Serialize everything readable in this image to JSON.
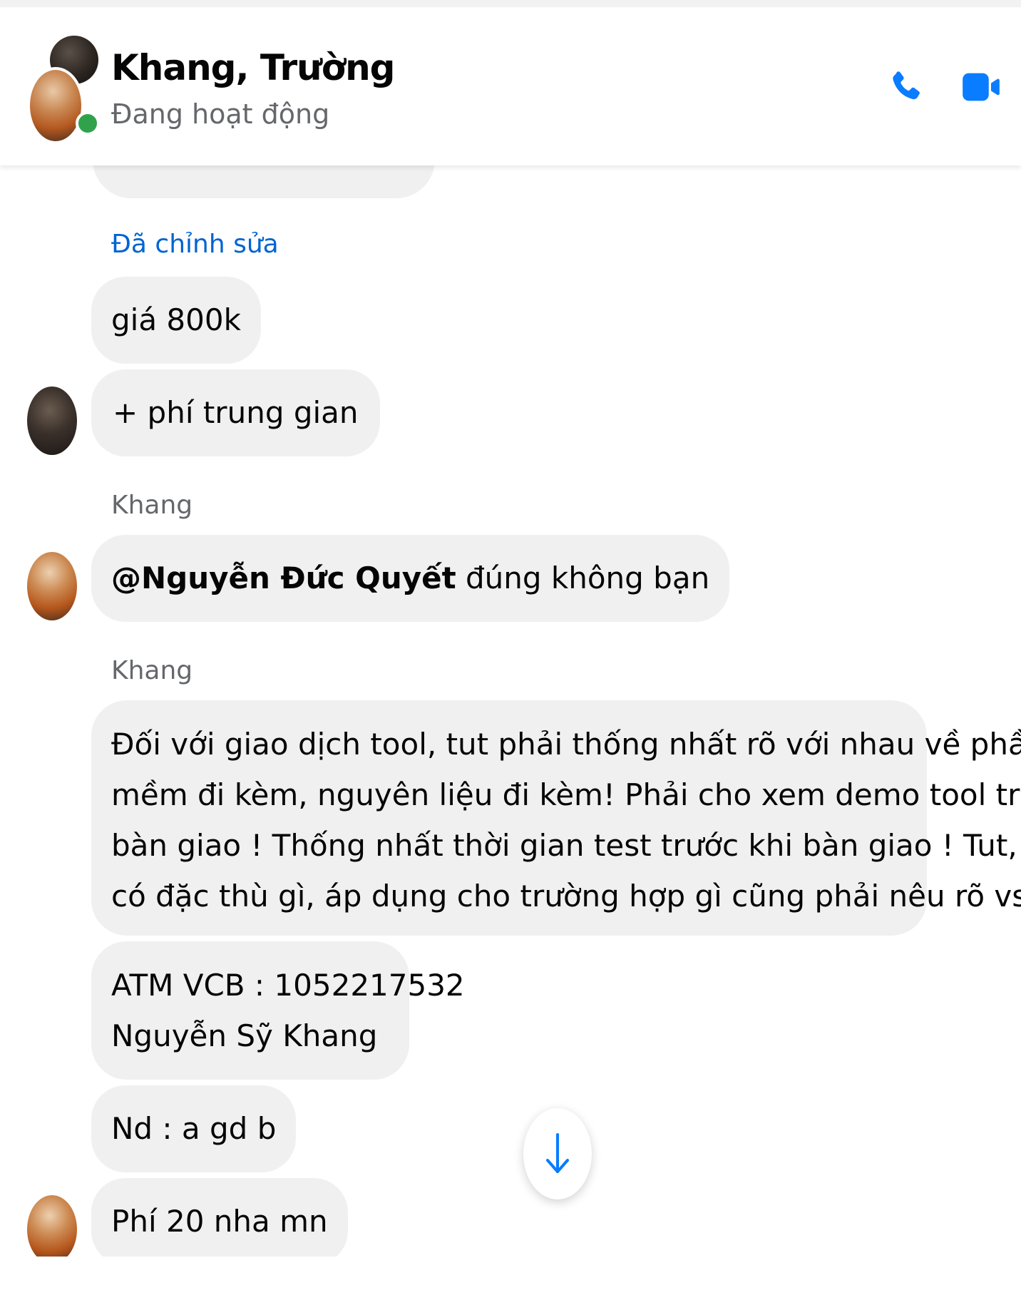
{
  "header": {
    "title": "Khang, Trường",
    "status": "Đang hoạt động",
    "icons": {
      "call": "phone-icon",
      "video": "video-camera-icon"
    },
    "accent_color": "#0a7cff",
    "online_color": "#31a24c"
  },
  "messages": {
    "edited_label": "Đã chỉnh sửa",
    "price": "giá 800k",
    "fee": "+ phí trung gian",
    "sender_1": "Khang",
    "mention_name": "@Nguyễn Đức Quyết",
    "mention_rest": " đúng không bạn",
    "sender_2": "Khang",
    "rules_lines": [
      "Đối với giao dịch tool, tut phải thống nhất rõ với nhau về phần",
      "mềm đi kèm, nguyên liệu đi kèm! Phải cho xem demo tool trước khi",
      "bàn giao ! Thống nhất thời gian test trước khi bàn giao ! Tut, tool",
      "có đặc thù gì, áp dụng cho trường hợp gì cũng phải nêu rõ vs nhau."
    ],
    "atm_line": "ATM VCB :  1052217532",
    "atm_name": "Nguyễn Sỹ Khang",
    "content_note": "Nd : a gd b",
    "fee_note": "Phí 20 nha mn"
  },
  "scroll_button": {
    "icon": "arrow-down-icon"
  }
}
